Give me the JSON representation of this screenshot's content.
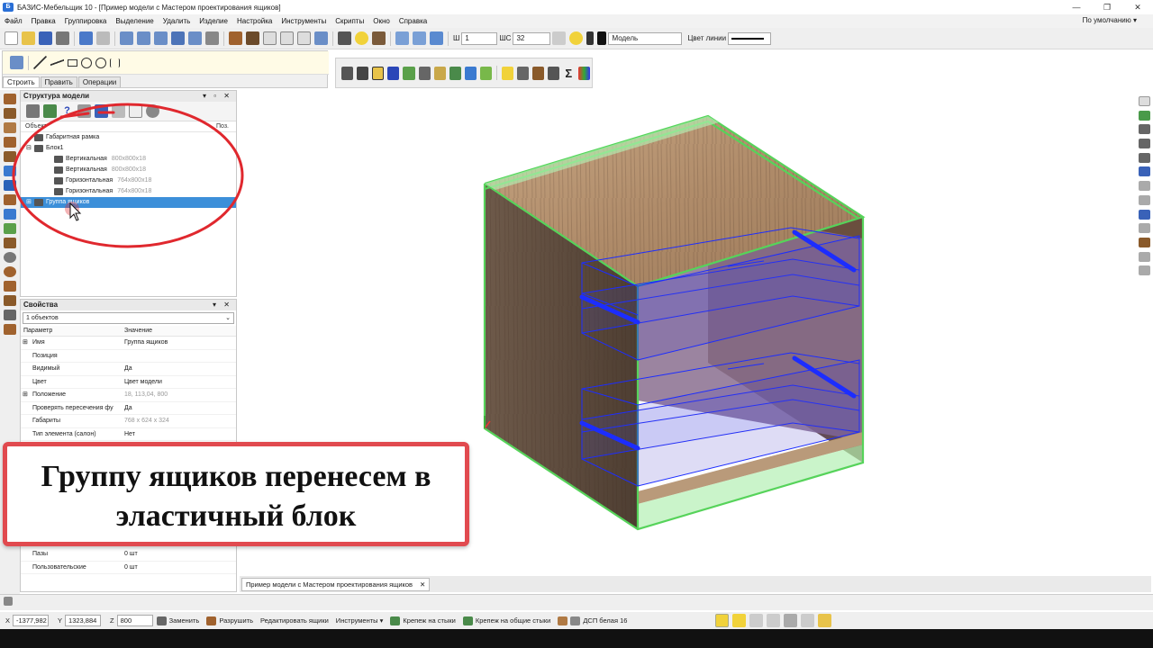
{
  "window": {
    "title": "БАЗИС-Мебельщик 10 - [Пример модели с Мастером проектирования ящиков]",
    "controls": [
      "—",
      "❐",
      "✕"
    ],
    "app_badge": "Б"
  },
  "menu": {
    "items": [
      "Файл",
      "Правка",
      "Группировка",
      "Выделение",
      "Удалить",
      "Изделие",
      "Настройка",
      "Инструменты",
      "Скрипты",
      "Окно",
      "Справка"
    ],
    "right_label": "По умолчанию ▾"
  },
  "toolbar": {
    "w_label": "Ш",
    "w_value": "1",
    "ws_label": "ШС",
    "ws_value": "32",
    "layer_value": "Модель",
    "line_color_label": "Цвет линии"
  },
  "draw_panel": {
    "tabs": [
      "Строить",
      "Править",
      "Операции"
    ]
  },
  "structure": {
    "title": "Структура модели",
    "col_object": "Объект",
    "col_pos": "Поз.",
    "rows": [
      {
        "label": "Габаритная рамка",
        "dim": "",
        "indent": 0,
        "expander": "",
        "selected": false
      },
      {
        "label": "Блок1",
        "dim": "",
        "indent": 0,
        "expander": "⊟",
        "selected": false
      },
      {
        "label": "Вертикальная",
        "dim": "800x800x18",
        "indent": 1,
        "expander": "",
        "selected": false
      },
      {
        "label": "Вертикальная",
        "dim": "800x800x18",
        "indent": 1,
        "expander": "",
        "selected": false
      },
      {
        "label": "Горизонтальная",
        "dim": "764x800x18",
        "indent": 1,
        "expander": "",
        "selected": false
      },
      {
        "label": "Горизонтальная",
        "dim": "764x800x18",
        "indent": 1,
        "expander": "",
        "selected": false
      },
      {
        "label": "Группа ящиков",
        "dim": "",
        "indent": 0,
        "expander": "⊞",
        "selected": true
      }
    ]
  },
  "properties": {
    "title": "Свойства",
    "selector": "1 объектов",
    "col_param": "Параметр",
    "col_value": "Значение",
    "rows": [
      {
        "name": "Имя",
        "value": "Группа ящиков",
        "expand": "⊞",
        "dim": false
      },
      {
        "name": "Позиция",
        "value": "",
        "expand": "",
        "dim": false
      },
      {
        "name": "Видимый",
        "value": "Да",
        "expand": "",
        "dim": false
      },
      {
        "name": "Цвет",
        "value": "Цвет модели",
        "expand": "",
        "dim": false
      },
      {
        "name": "Положение",
        "value": "18, 113,04, 800",
        "expand": "⊞",
        "dim": true
      },
      {
        "name": "Проверять пересечения фу",
        "value": "Да",
        "expand": "",
        "dim": false
      },
      {
        "name": "Габариты",
        "value": "768 x 624 x 324",
        "expand": "",
        "dim": true
      },
      {
        "name": "Тип элемента (салон)",
        "value": "Нет",
        "expand": "",
        "dim": false
      }
    ],
    "bottom_rows": [
      {
        "name": "Пазы",
        "value": "0 шт"
      },
      {
        "name": "Пользовательские",
        "value": "0 шт"
      }
    ]
  },
  "caption": {
    "line1": "Группу ящиков перенесем в",
    "line2": "эластичный блок"
  },
  "doc_tab": {
    "label": "Пример модели с Мастером проектирования ящиков",
    "close": "✕"
  },
  "status": {
    "x_label": "X",
    "x_value": "-1377,982",
    "y_label": "Y",
    "y_value": "1323,884",
    "z_label": "Z",
    "z_value": "800",
    "buttons": [
      "Заменить",
      "Разрушить",
      "Редактировать ящики",
      "Инструменты ▾",
      "Крепеж на стыки",
      "Крепеж на общие стыки"
    ],
    "material": "ДСП белая 16"
  },
  "colors": {
    "accent_blue": "#3c8fd9",
    "annotation_red": "#e0282e",
    "caption_border": "#e14a4f",
    "edge_green": "#56d35a",
    "drawer_blue": "#1c2dff",
    "wood_dark": "#5b4a3e",
    "wood_light": "#b08c6a"
  }
}
